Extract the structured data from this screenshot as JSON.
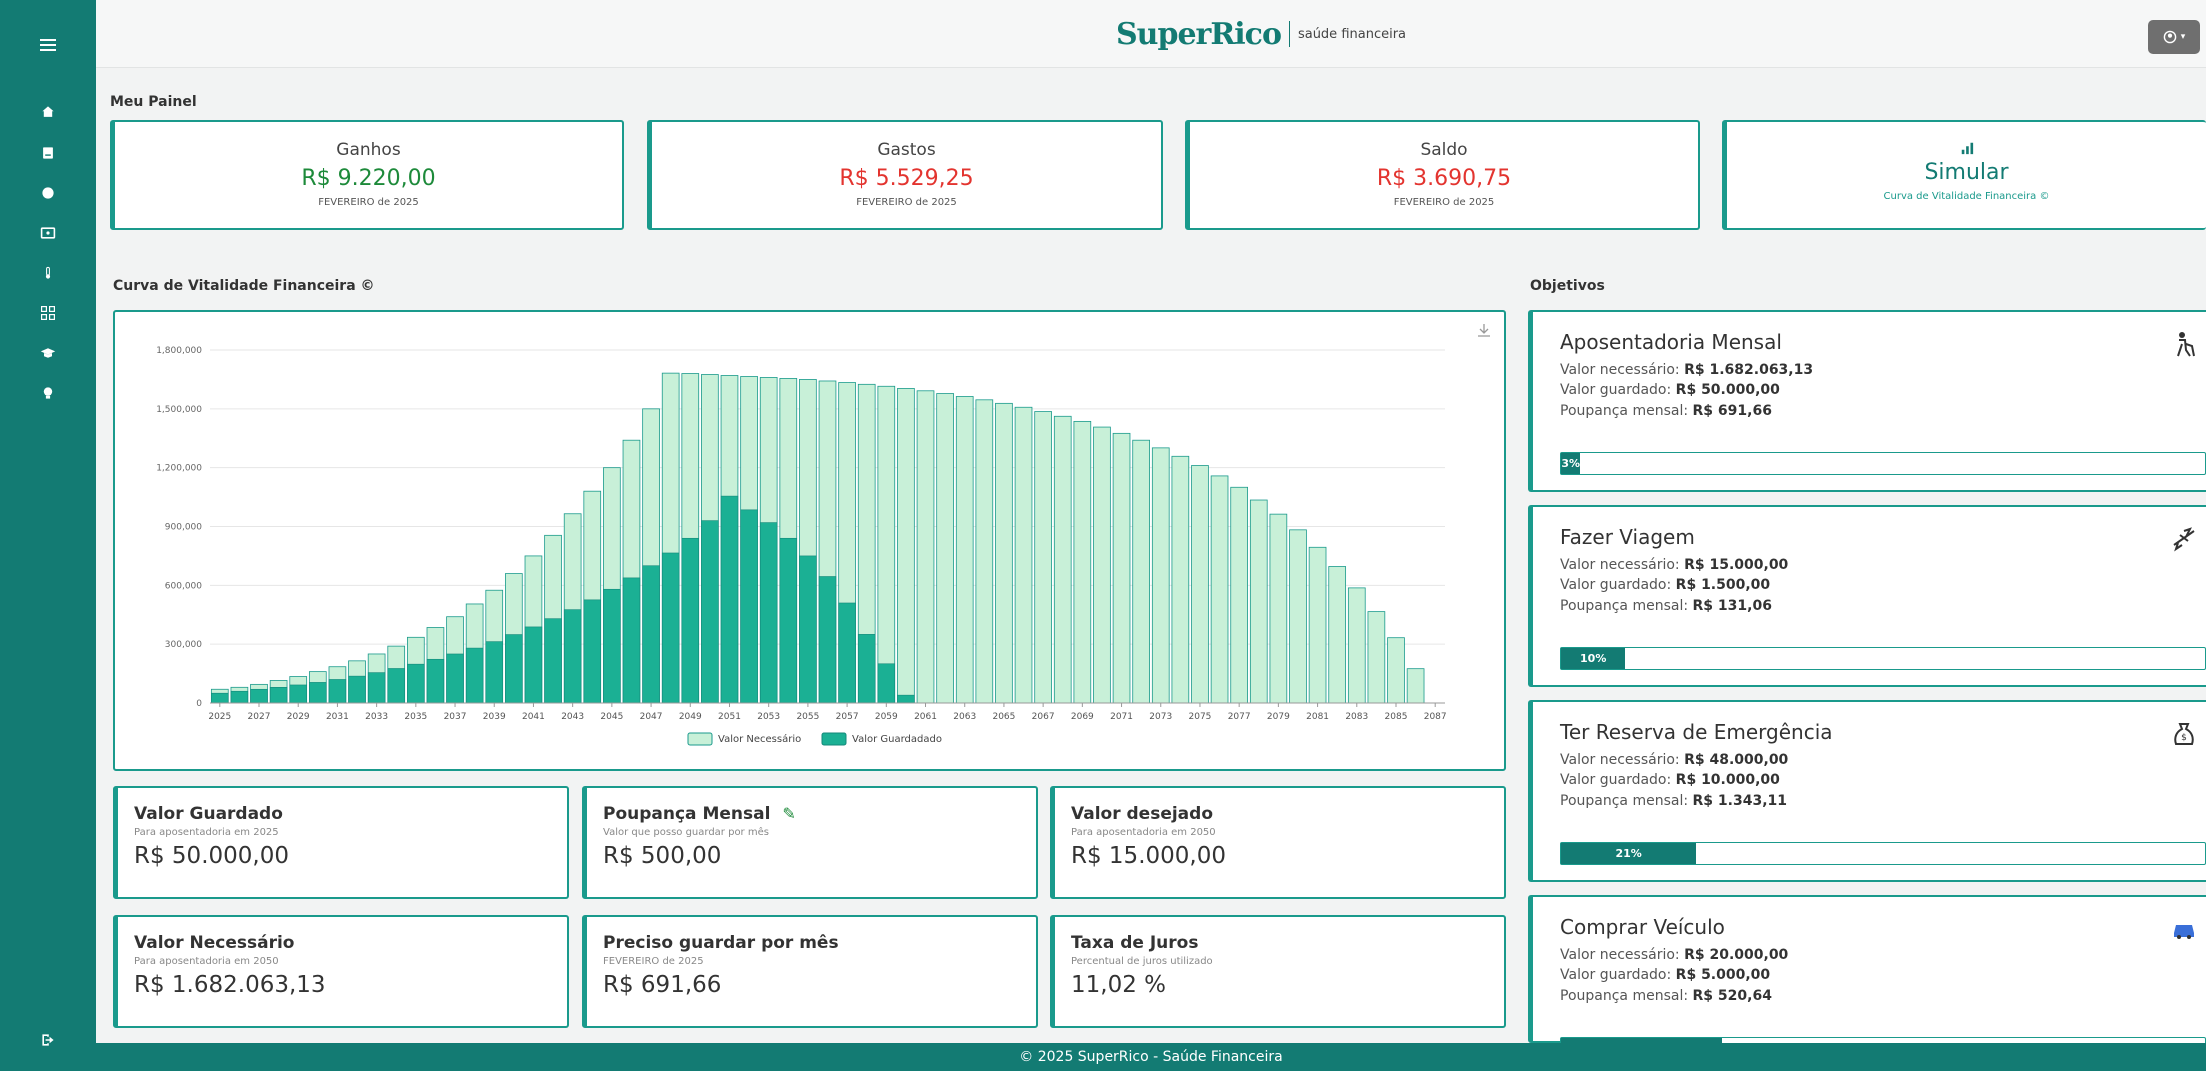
{
  "brand": {
    "logo": "SuperRico",
    "tagline": "saúde financeira"
  },
  "sidebar": {
    "items": [
      {
        "icon": "menu-icon"
      },
      {
        "icon": "home-icon"
      },
      {
        "icon": "wallet-icon"
      },
      {
        "icon": "globe-icon"
      },
      {
        "icon": "money-icon"
      },
      {
        "icon": "thermometer-icon"
      },
      {
        "icon": "grid-icon"
      },
      {
        "icon": "graduation-icon"
      },
      {
        "icon": "lightbulb-icon"
      },
      {
        "icon": "logout-icon"
      }
    ]
  },
  "user_button": {
    "icon": "user-icon",
    "caret": "▾"
  },
  "panel_title": "Meu Painel",
  "stats": [
    {
      "label": "Ganhos",
      "value": "R$ 9.220,00",
      "sub": "FEVEREIRO de 2025",
      "color": "#1d8a3a"
    },
    {
      "label": "Gastos",
      "value": "R$ 5.529,25",
      "sub": "FEVEREIRO de 2025",
      "color": "#e3342f"
    },
    {
      "label": "Saldo",
      "value": "R$ 3.690,75",
      "sub": "FEVEREIRO de 2025",
      "color": "#e3342f"
    }
  ],
  "simulate": {
    "label": "Simular",
    "sub": "Curva de Vitalidade Financeira ©",
    "icon": "bar-chart-icon"
  },
  "chart_title": "Curva de Vitalidade Financeira ©",
  "chart_data": {
    "type": "bar",
    "categories": [
      "2025",
      "2026",
      "2027",
      "2028",
      "2029",
      "2030",
      "2031",
      "2032",
      "2033",
      "2034",
      "2035",
      "2036",
      "2037",
      "2038",
      "2039",
      "2040",
      "2041",
      "2042",
      "2043",
      "2044",
      "2045",
      "2046",
      "2047",
      "2048",
      "2049",
      "2050",
      "2051",
      "2052",
      "2053",
      "2054",
      "2055",
      "2056",
      "2057",
      "2058",
      "2059",
      "2060",
      "2061",
      "2062",
      "2063",
      "2064",
      "2065",
      "2066",
      "2067",
      "2068",
      "2069",
      "2070",
      "2071",
      "2072",
      "2073",
      "2074",
      "2075",
      "2076",
      "2077",
      "2078",
      "2079",
      "2080",
      "2081",
      "2082",
      "2083",
      "2084",
      "2085",
      "2086",
      "2087"
    ],
    "x_tick_labels": [
      "2025",
      "2027",
      "2029",
      "2031",
      "2033",
      "2035",
      "2037",
      "2039",
      "2041",
      "2043",
      "2045",
      "2047",
      "2049",
      "2051",
      "2053",
      "2055",
      "2057",
      "2059",
      "2061",
      "2063",
      "2065",
      "2067",
      "2069",
      "2071",
      "2073",
      "2075",
      "2077",
      "2079",
      "2081",
      "2083",
      "2085",
      "2087"
    ],
    "series": [
      {
        "name": "Valor Necessário",
        "color": "#c8f0d8",
        "values": [
          70000,
          80000,
          95000,
          115000,
          135000,
          160000,
          185000,
          215000,
          250000,
          290000,
          335000,
          385000,
          440000,
          505000,
          575000,
          660000,
          750000,
          855000,
          965000,
          1080000,
          1200000,
          1340000,
          1500000,
          1682000,
          1680000,
          1675000,
          1670000,
          1665000,
          1660000,
          1655000,
          1650000,
          1642000,
          1634000,
          1625000,
          1615000,
          1604000,
          1592000,
          1578000,
          1563000,
          1546000,
          1528000,
          1508000,
          1486000,
          1462000,
          1436000,
          1407000,
          1375000,
          1340000,
          1301000,
          1258000,
          1211000,
          1158000,
          1100000,
          1035000,
          963000,
          883000,
          794000,
          696000,
          587000,
          466000,
          333000,
          175000
        ]
      },
      {
        "name": "Valor Guardadado",
        "color": "#1bb094",
        "values": [
          50000,
          60000,
          70000,
          80000,
          92000,
          105000,
          120000,
          137000,
          155000,
          176000,
          198000,
          223000,
          250000,
          280000,
          313000,
          349000,
          388000,
          430000,
          476000,
          526000,
          580000,
          638000,
          700000,
          765000,
          840000,
          930000,
          1055000,
          985000,
          920000,
          840000,
          750000,
          645000,
          510000,
          350000,
          200000,
          40000,
          0,
          0,
          0,
          0,
          0,
          0,
          0,
          0,
          0,
          0,
          0,
          0,
          0,
          0,
          0,
          0,
          0,
          0,
          0,
          0,
          0,
          0,
          0,
          0,
          0,
          0
        ]
      }
    ],
    "y_ticks": [
      "0",
      "300,000",
      "600,000",
      "900,000",
      "1,200,000",
      "1,500,000",
      "1,800,000"
    ],
    "ylim": [
      0,
      1800000
    ],
    "legend_position": "bottom"
  },
  "download_icon": "download-icon",
  "info_cards": [
    {
      "title": "Valor Guardado",
      "sub": "Para aposentadoria em 2025",
      "value": "R$ 50.000,00"
    },
    {
      "title": "Poupança Mensal",
      "sub": "Valor que posso guardar por mês",
      "value": "R$ 500,00",
      "edit_icon": "pencil-icon"
    },
    {
      "title": "Valor desejado",
      "sub": "Para aposentadoria em 2050",
      "value": "R$ 15.000,00"
    },
    {
      "title": "Valor Necessário",
      "sub": "Para aposentadoria em 2050",
      "value": "R$ 1.682.063,13"
    },
    {
      "title": "Preciso guardar por mês",
      "sub": "FEVEREIRO de 2025",
      "value": "R$ 691,66"
    },
    {
      "title": "Taxa de Juros",
      "sub": "Percentual de juros utilizado",
      "value": "11,02 %"
    }
  ],
  "objectives_title": "Objetivos",
  "goals": [
    {
      "title": "Aposentadoria Mensal",
      "icon": "elderly-icon",
      "needed_label": "Valor necessário:",
      "needed": "R$ 1.682.063,13",
      "saved_label": "Valor guardado:",
      "saved": "R$ 50.000,00",
      "monthly_label": "Poupança mensal:",
      "monthly": "R$ 691,66",
      "progress": "3%",
      "progress_value": 3
    },
    {
      "title": "Fazer Viagem",
      "icon": "airplane-icon",
      "needed_label": "Valor necessário:",
      "needed": "R$ 15.000,00",
      "saved_label": "Valor guardado:",
      "saved": "R$ 1.500,00",
      "monthly_label": "Poupança mensal:",
      "monthly": "R$ 131,06",
      "progress": "10%",
      "progress_value": 10
    },
    {
      "title": "Ter Reserva de Emergência",
      "icon": "money-bag-icon",
      "needed_label": "Valor necessário:",
      "needed": "R$ 48.000,00",
      "saved_label": "Valor guardado:",
      "saved": "R$ 10.000,00",
      "monthly_label": "Poupança mensal:",
      "monthly": "R$ 1.343,11",
      "progress": "21%",
      "progress_value": 21
    },
    {
      "title": "Comprar Veículo",
      "icon": "car-icon",
      "needed_label": "Valor necessário:",
      "needed": "R$ 20.000,00",
      "saved_label": "Valor guardado:",
      "saved": "R$ 5.000,00",
      "monthly_label": "Poupança mensal:",
      "monthly": "R$ 520,64",
      "progress": "",
      "progress_value": 25
    }
  ],
  "footer": "© 2025 SuperRico - Saúde Financeira"
}
